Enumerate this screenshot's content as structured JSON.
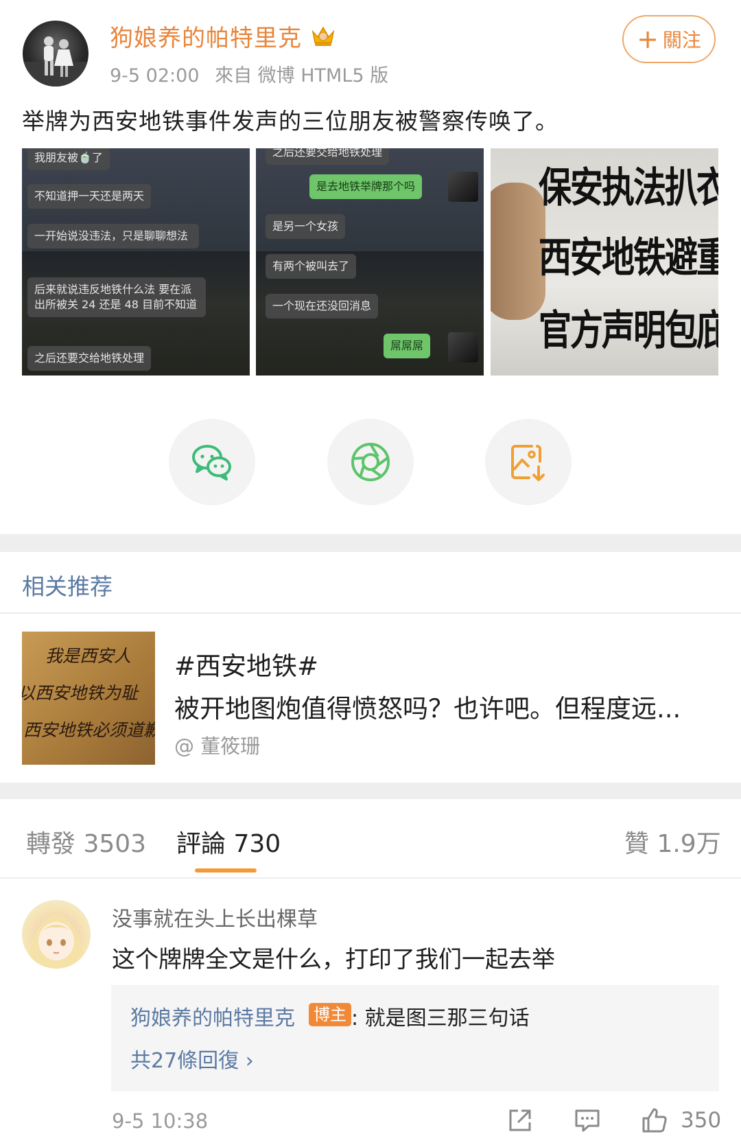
{
  "post": {
    "author": "狗娘养的帕特里克",
    "time": "9-5 02:00",
    "source": "來自 微博 HTML5 版",
    "follow_label": "關注",
    "text": "举牌为西安地铁事件发声的三位朋友被警察传唤了。"
  },
  "images": {
    "chat1": [
      "我朋友被🍵了",
      "不知道押一天还是两天",
      "一开始说没违法，只是聊聊想法",
      "后来就说违反地铁什么法 要在派出所被关 24 还是 48 目前不知道",
      "之后还要交给地铁处理"
    ],
    "chat2": [
      "之后还要交给地铁处理",
      "是去地铁举牌那个吗",
      "是另一个女孩",
      "有两个被叫去了",
      "一个现在还没回消息",
      "屌屌屌"
    ],
    "placard": [
      "保安执法扒衣拖行",
      "西安地铁避重就轻",
      "官方声明包庇旧护"
    ]
  },
  "share_icons": [
    "wechat-icon",
    "moments-icon",
    "save-image-icon"
  ],
  "related": {
    "heading": "相关推荐",
    "thumb_text": [
      "我是西安人",
      "以西安地铁为耻",
      "西安地铁必须道歉"
    ],
    "topic": "#西安地铁#",
    "excerpt": "被开地图炮值得愤怒吗？也许吧。但程度远...",
    "author": "@ 董筱珊"
  },
  "tabs": {
    "repost": "轉發 3503",
    "comments": "評論 730",
    "likes": "贊 1.9万"
  },
  "comment": {
    "user": "没事就在头上长出棵草",
    "text": "这个牌牌全文是什么，打印了我们一起去举",
    "reply_user": "狗娘养的帕特里克",
    "reply_badge": "博主",
    "reply_text": ": 就是图三那三句话",
    "more_replies": "共27條回復 ›",
    "time": "9-5 10:38",
    "like_count": "350"
  },
  "colors": {
    "accent_orange": "#e8853b",
    "link_blue": "#5b7aa3",
    "wechat_green": "#3dbb78",
    "moments_green": "#5cc46a",
    "save_orange": "#f0a030"
  }
}
